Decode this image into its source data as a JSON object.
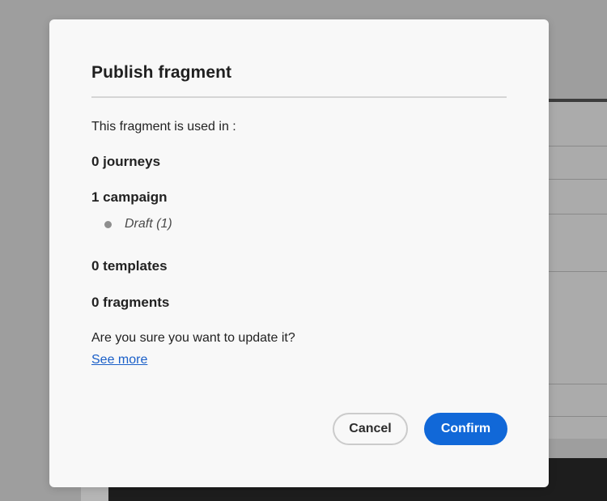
{
  "dialog": {
    "title": "Publish fragment",
    "intro": "This fragment is used in :",
    "journeys": "0 journeys",
    "campaigns": "1 campaign",
    "campaign_items": [
      "Draft (1)"
    ],
    "templates": "0 templates",
    "fragments": "0 fragments",
    "question": "Are you sure you want to update it?",
    "see_more": "See more",
    "cancel_label": "Cancel",
    "confirm_label": "Confirm"
  },
  "colors": {
    "accent": "#1168d8",
    "link": "#1a5fc8",
    "overlay": "#9e9e9e"
  }
}
